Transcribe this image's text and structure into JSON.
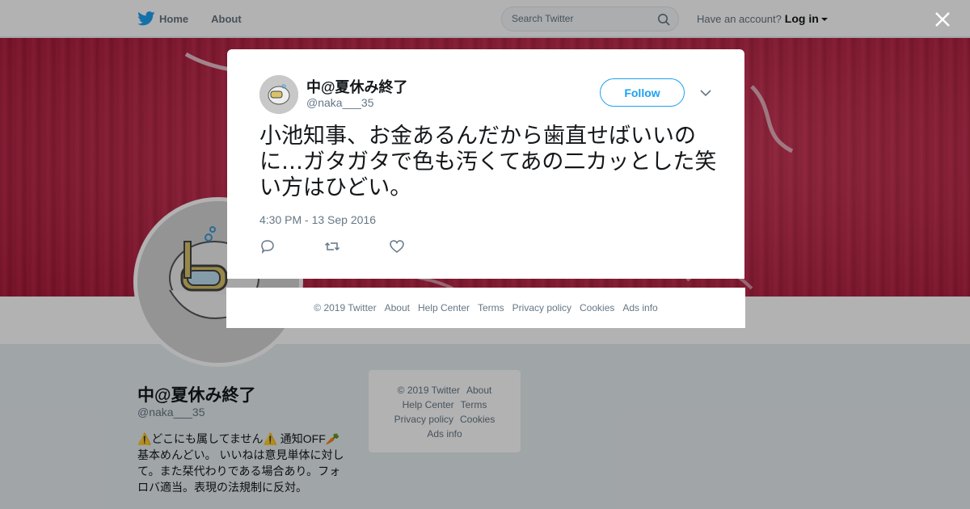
{
  "topbar": {
    "home_label": "Home",
    "about_label": "About",
    "search_placeholder": "Search Twitter",
    "account_prompt": "Have an account?",
    "login_label": "Log in"
  },
  "profile": {
    "name": "中@夏休み終了",
    "handle": "@naka___35",
    "bio_line1": "⚠️どこにも属してません⚠️ 通知OFF🥕",
    "bio_line2": "基本めんどい。 いいねは意見単体に対して。また栞代わりである場合あり。フォロバ適当。表現の法規制に反対。"
  },
  "sidebar_footer": {
    "items": [
      "© 2019 Twitter",
      "About",
      "Help Center",
      "Terms",
      "Privacy policy",
      "Cookies",
      "Ads info"
    ]
  },
  "tweet": {
    "author_name": "中@夏休み終了",
    "author_handle": "@naka___35",
    "follow_label": "Follow",
    "text": "小池知事、お金あるんだから歯直せばいいのに…ガタガタで色も汚くてあの二カッとした笑い方はひどい。",
    "timestamp": "4:30 PM - 13 Sep 2016"
  },
  "modal_footer": {
    "items": [
      "© 2019 Twitter",
      "About",
      "Help Center",
      "Terms",
      "Privacy policy",
      "Cookies",
      "Ads info"
    ]
  },
  "colors": {
    "accent": "#1da1f2",
    "banner": "#c21f45",
    "muted_text": "#657786"
  },
  "icons": [
    "twitter-bird-icon",
    "search-icon",
    "caret-down-icon",
    "close-icon",
    "chevron-down-icon",
    "reply-icon",
    "retweet-icon",
    "like-icon"
  ]
}
